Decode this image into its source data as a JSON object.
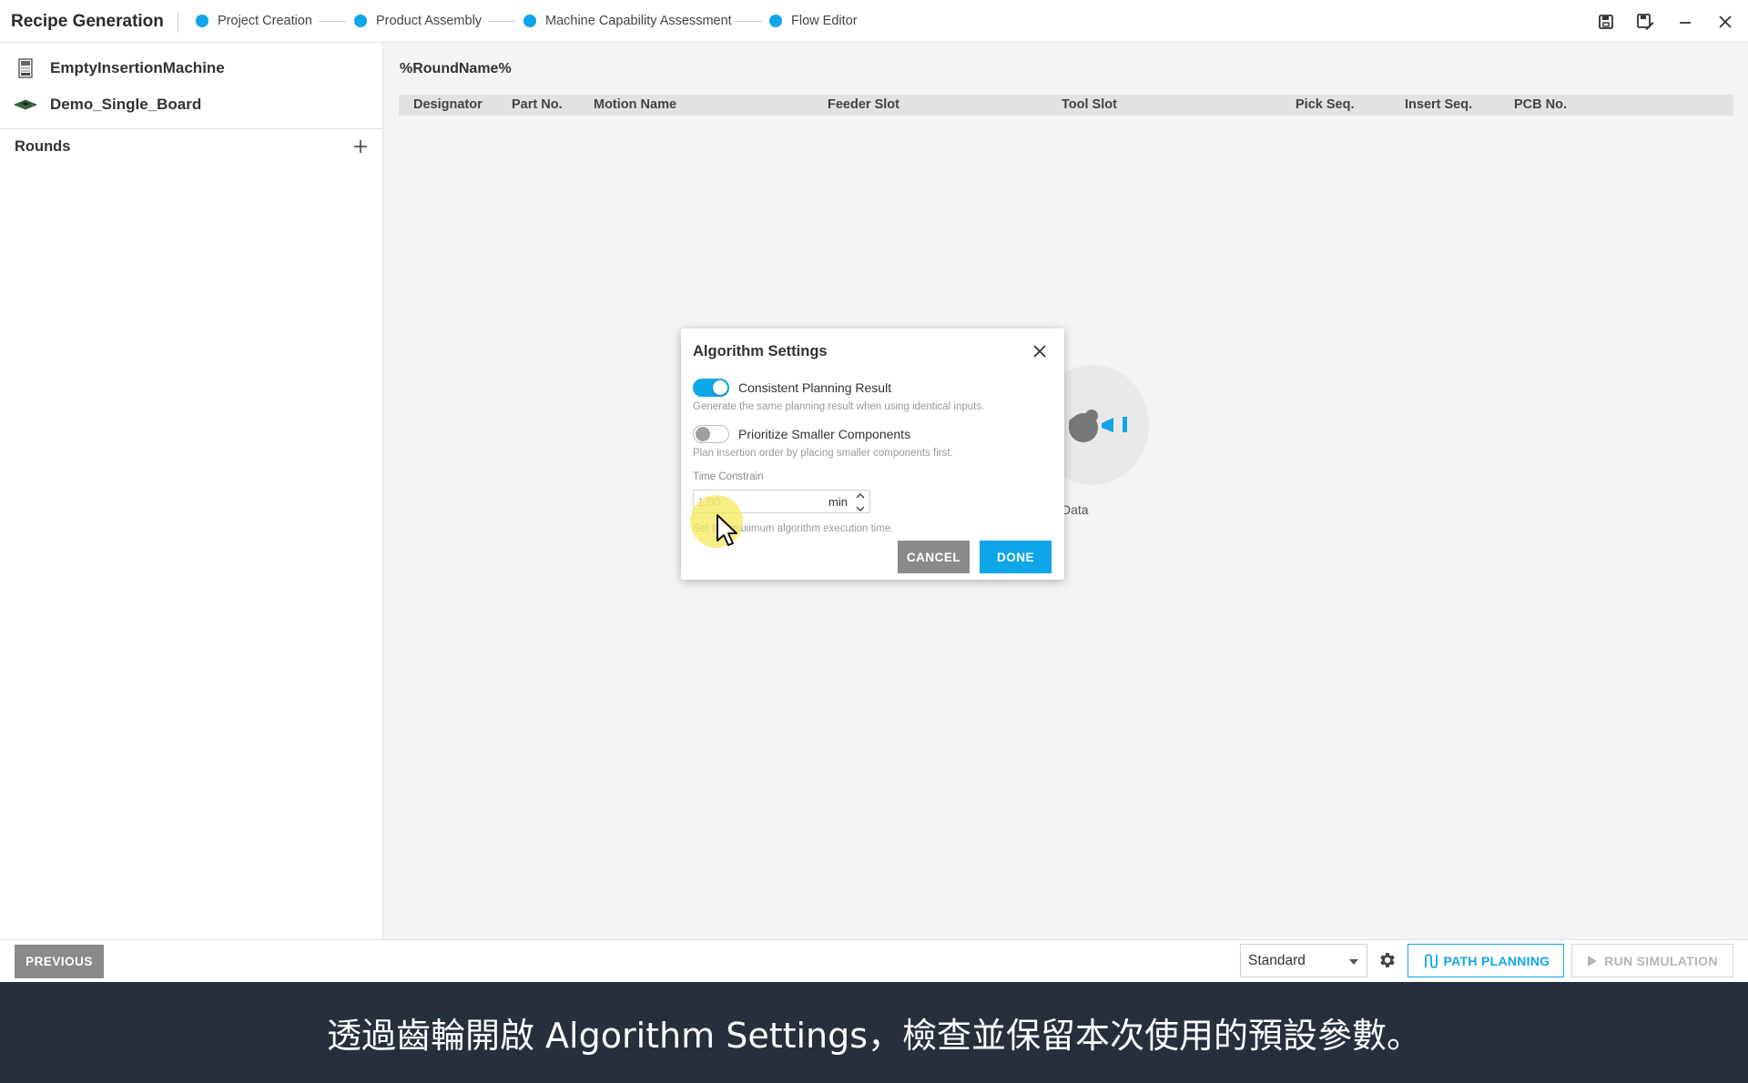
{
  "app": {
    "title": "Recipe Generation"
  },
  "steps": [
    {
      "label": "Project Creation"
    },
    {
      "label": "Product Assembly"
    },
    {
      "label": "Machine Capability Assessment"
    },
    {
      "label": "Flow Editor"
    }
  ],
  "window_controls": [
    "save-icon",
    "save-as-icon",
    "minimize-icon",
    "close-icon"
  ],
  "sidebar": {
    "items": [
      {
        "label": "EmptyInsertionMachine",
        "icon": "machine-icon"
      },
      {
        "label": "Demo_Single_Board",
        "icon": "board-icon"
      }
    ],
    "rounds_label": "Rounds"
  },
  "main": {
    "round_name": "%RoundName%",
    "columns": [
      "Designator",
      "Part No.",
      "Motion Name",
      "Feeder Slot",
      "Tool Slot",
      "Pick Seq.",
      "Insert Seq.",
      "PCB No."
    ],
    "placeholder_text": "Data"
  },
  "dialog": {
    "title": "Algorithm Settings",
    "options": [
      {
        "label": "Consistent Planning Result",
        "help": "Generate the same planning result when using identical inputs.",
        "enabled": true
      },
      {
        "label": "Prioritize Smaller Components",
        "help": "Plan insertion order by placing smaller components first.",
        "enabled": false
      }
    ],
    "time_constrain": {
      "label": "Time Constrain",
      "value": "1.00",
      "unit": "min",
      "help": "Set the maximum algorithm execution time."
    },
    "cancel_label": "CANCEL",
    "done_label": "DONE"
  },
  "bottombar": {
    "previous_label": "PREVIOUS",
    "mode_value": "Standard",
    "path_planning_label": "PATH PLANNING",
    "run_simulation_label": "RUN SIMULATION"
  },
  "caption": {
    "text": "透過齒輪開啟 Algorithm Settings，檢查並保留本次使用的預設參數。"
  },
  "colors": {
    "accent": "#0ea5e9",
    "gray_button": "#8a8a8a",
    "caption_bg": "#262f3b"
  }
}
